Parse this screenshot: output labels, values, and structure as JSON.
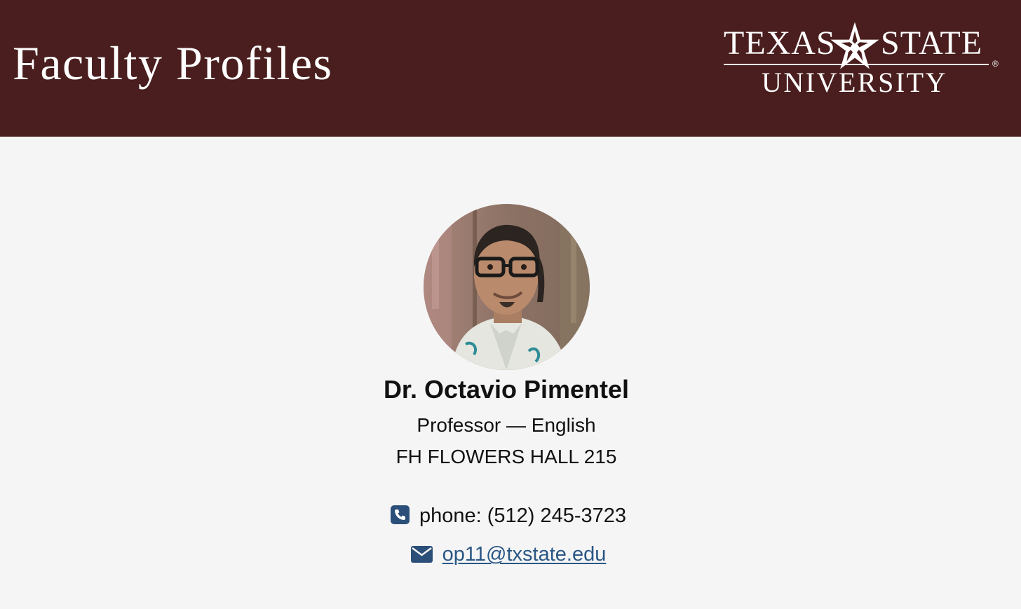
{
  "header": {
    "site_title": "Faculty Profiles",
    "background_color": "#4a1e1e",
    "logo": {
      "word_left": "TEXAS",
      "word_right": "STATE",
      "word_bottom": "UNIVERSITY",
      "registered_mark": "®",
      "star_icon": "star-icon"
    }
  },
  "profile": {
    "photo_icon": "faculty-photo",
    "name": "Dr. Octavio Pimentel",
    "title": "Professor — English",
    "office": "FH FLOWERS HALL 215",
    "phone_icon": "phone-icon",
    "phone_label": "phone: (512) 245-3723",
    "email_icon": "envelope-icon",
    "email": "op11@txstate.edu",
    "link_color": "#2a5785",
    "icon_color": "#2b4f78"
  }
}
